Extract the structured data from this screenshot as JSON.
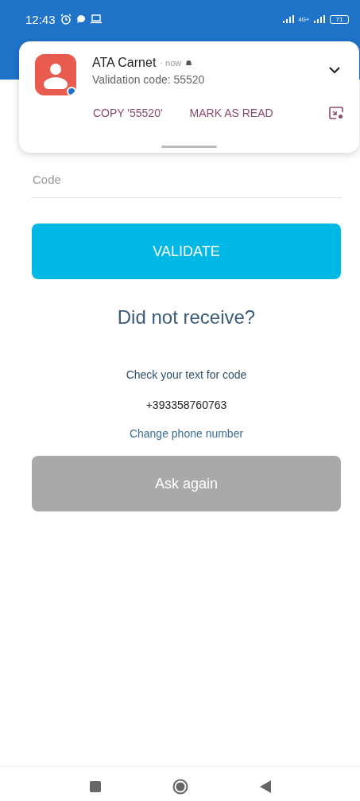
{
  "status_bar": {
    "time": "12:43",
    "network": "4G+",
    "battery": "71"
  },
  "notification": {
    "app": "ATA Carnet",
    "time": "· now",
    "message": "Validation code: 55520",
    "expanded": false,
    "actions": [
      "COPY '55520'",
      "MARK AS READ"
    ]
  },
  "form": {
    "code": {
      "placeholder": "Code"
    },
    "validate": "VALIDATE"
  },
  "resend": {
    "title": "Did not receive?",
    "hint": "Check your text for code",
    "phone": "+393358760763",
    "change_link": "Change phone number",
    "ask_again": {
      "label": "Ask again",
      "disabled": true
    }
  }
}
